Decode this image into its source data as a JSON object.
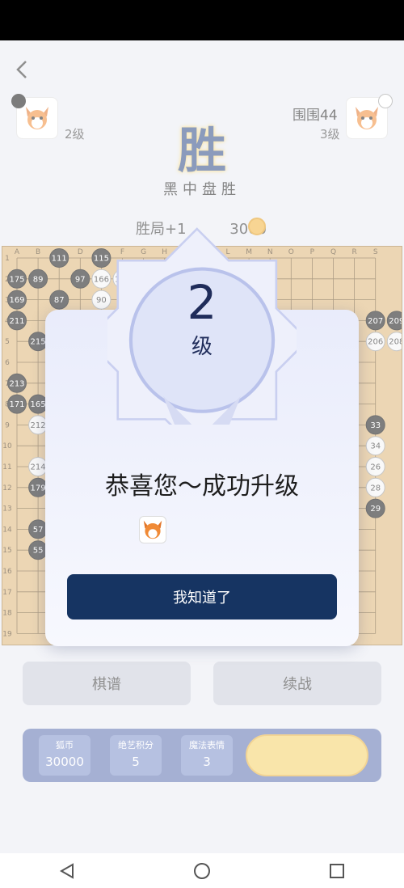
{
  "header": {
    "back_icon": "chevron-left-icon"
  },
  "players": {
    "left": {
      "level": "2级"
    },
    "right": {
      "name": "围围44",
      "level": "3级"
    }
  },
  "result": {
    "big": "胜",
    "sub": "黑中盘胜",
    "reward_label": "胜局+1",
    "reward_coins": "3000"
  },
  "board": {
    "columns": [
      "A",
      "B",
      "C",
      "D",
      "E",
      "F",
      "G",
      "H",
      "J",
      "K",
      "L",
      "M",
      "N",
      "O",
      "P",
      "Q",
      "R",
      "S"
    ],
    "rows": [
      "1",
      "2",
      "3",
      "4",
      "5",
      "6",
      "7",
      "8",
      "9",
      "10",
      "11",
      "12",
      "13",
      "14",
      "15",
      "16",
      "17",
      "18",
      "19"
    ],
    "stone_numbers": [
      "111",
      "115",
      "175",
      "89",
      "97",
      "166",
      "108",
      "169",
      "87",
      "90",
      "211",
      "215",
      "207",
      "209",
      "206",
      "208",
      "213",
      "171",
      "165",
      "212",
      "33",
      "34",
      "214",
      "26",
      "179",
      "28",
      "29",
      "57",
      "55"
    ]
  },
  "actions": {
    "record": "棋谱",
    "continue": "续战"
  },
  "stats": [
    {
      "label": "狐币",
      "value": "30000"
    },
    {
      "label": "绝艺积分",
      "value": "5"
    },
    {
      "label": "魔法表情",
      "value": "3"
    }
  ],
  "modal": {
    "level_number": "2",
    "level_unit": "级",
    "message": "恭喜您～成功升级",
    "button": "我知道了"
  },
  "colors": {
    "primary": "#163462",
    "accent_gold": "#f2b33b",
    "board": "#dcb577"
  }
}
